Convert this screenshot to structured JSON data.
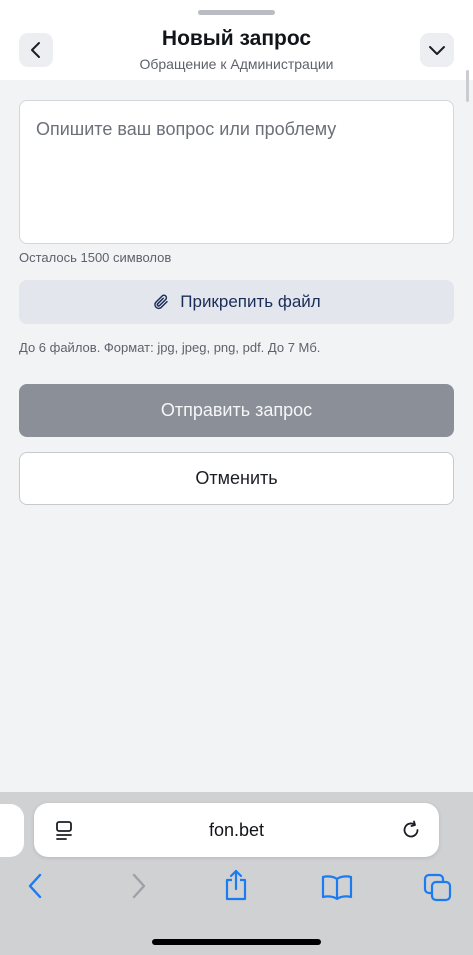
{
  "header": {
    "title": "Новый запрос",
    "subtitle": "Обращение к Администрации"
  },
  "form": {
    "message_placeholder": "Опишите ваш вопрос или проблему",
    "message_value": "",
    "chars_left": "Осталось 1500 символов",
    "attach_label": "Прикрепить файл",
    "attach_hint": "До 6 файлов. Формат: jpg, jpeg, png, pdf. До 7 Мб.",
    "submit_label": "Отправить запрос",
    "cancel_label": "Отменить"
  },
  "browser": {
    "url": "fon.bet"
  },
  "colors": {
    "accent": "#1a7cf0",
    "submit_disabled": "#8a8f98",
    "attach_bg": "#e3e6ed"
  }
}
